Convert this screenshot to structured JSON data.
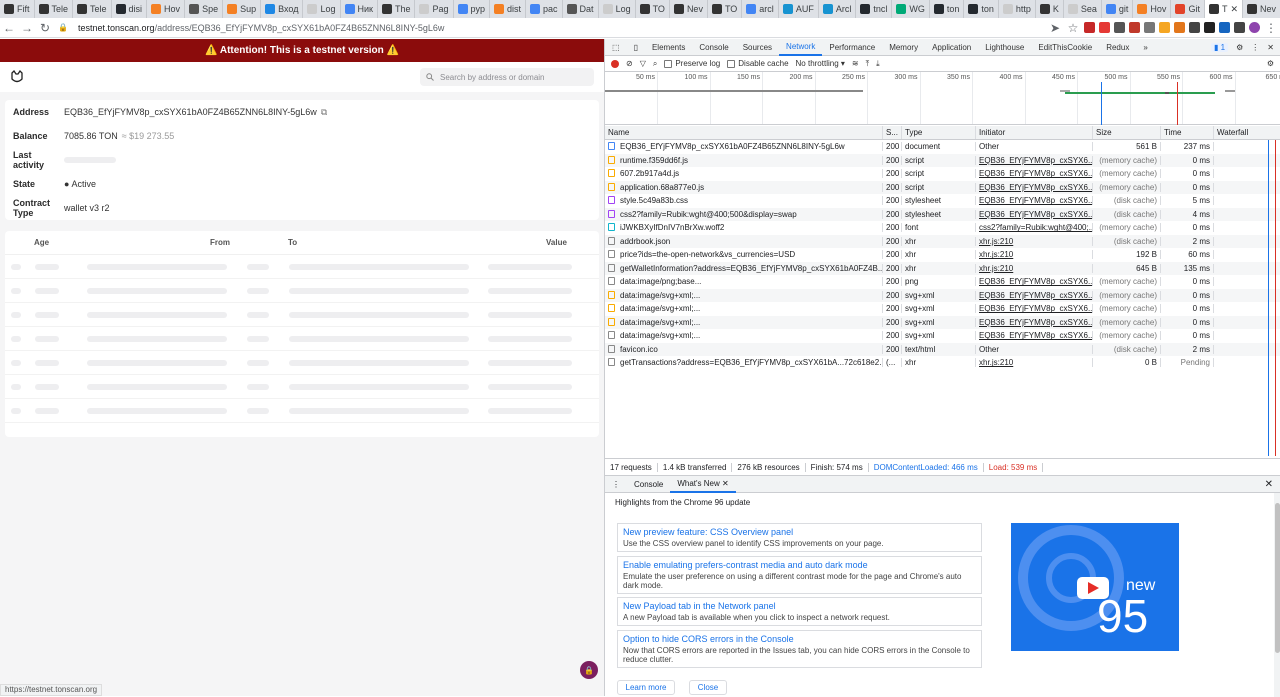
{
  "tabs": [
    {
      "label": "Fift",
      "color": "#333"
    },
    {
      "label": "Tele",
      "color": "#333"
    },
    {
      "label": "Tele",
      "color": "#333"
    },
    {
      "label": "disi",
      "color": "#24292f"
    },
    {
      "label": "Hov",
      "color": "#f48024"
    },
    {
      "label": "Spe",
      "color": "#555"
    },
    {
      "label": "Sup",
      "color": "#f48024"
    },
    {
      "label": "Вход",
      "color": "#1e88e5"
    },
    {
      "label": "Log",
      "color": "#ccc"
    },
    {
      "label": "Ник",
      "color": "#4285f4"
    },
    {
      "label": "The",
      "color": "#333"
    },
    {
      "label": "Pag",
      "color": "#ccc"
    },
    {
      "label": "pyp",
      "color": "#4285f4"
    },
    {
      "label": "dist",
      "color": "#f48024"
    },
    {
      "label": "pac",
      "color": "#4285f4"
    },
    {
      "label": "Dat",
      "color": "#555"
    },
    {
      "label": "Log",
      "color": "#ccc"
    },
    {
      "label": "TO",
      "color": "#333"
    },
    {
      "label": "Nev",
      "color": "#333"
    },
    {
      "label": "TO",
      "color": "#333"
    },
    {
      "label": "arcl",
      "color": "#4285f4"
    },
    {
      "label": "AUF",
      "color": "#1793d1"
    },
    {
      "label": "Arcl",
      "color": "#1793d1"
    },
    {
      "label": "tncl",
      "color": "#24292f"
    },
    {
      "label": "WG",
      "color": "#0a7"
    },
    {
      "label": "ton",
      "color": "#24292f"
    },
    {
      "label": "ton",
      "color": "#24292f"
    },
    {
      "label": "http",
      "color": "#ccc"
    },
    {
      "label": "K",
      "color": "#333"
    },
    {
      "label": "Sea",
      "color": "#ccc"
    },
    {
      "label": "git",
      "color": "#4285f4"
    },
    {
      "label": "Hov",
      "color": "#f48024"
    },
    {
      "label": "Git",
      "color": "#e24329"
    },
    {
      "label": "T",
      "color": "#333",
      "active": true
    },
    {
      "label": "Nev",
      "color": "#333"
    }
  ],
  "url": {
    "host": "testnet.tonscan.org",
    "path": "/address/EQB36_EfYjFYMV8p_cxSYX61bA0FZ4B65ZNN6L8INY-5gL6w"
  },
  "site": {
    "banner": "⚠️ Attention! This is a testnet version ⚠️",
    "search_placeholder": "Search by address or domain",
    "address_label": "Address",
    "address": "EQB36_EfYjFYMV8p_cxSYX61bA0FZ4B65ZNN6L8INY-5gL6w",
    "balance_label": "Balance",
    "balance": "7085.86 TON",
    "balance_usd": "≈ $19 273.55",
    "last_activity_label": "Last activity",
    "state_label": "State",
    "state": "● Active",
    "contract_label": "Contract Type",
    "contract": "wallet v3 r2",
    "cols": {
      "age": "Age",
      "from": "From",
      "to": "To",
      "value": "Value"
    },
    "status_url": "https://testnet.tonscan.org"
  },
  "devtools": {
    "tabs": [
      "Elements",
      "Console",
      "Sources",
      "Network",
      "Performance",
      "Memory",
      "Application",
      "Lighthouse",
      "EditThisCookie",
      "Redux"
    ],
    "badge": "1",
    "preserve_log": "Preserve log",
    "disable_cache": "Disable cache",
    "throttling": "No throttling",
    "timeline": [
      "50 ms",
      "100 ms",
      "150 ms",
      "200 ms",
      "250 ms",
      "300 ms",
      "350 ms",
      "400 ms",
      "450 ms",
      "500 ms",
      "550 ms",
      "600 ms",
      "650 m"
    ],
    "headers": [
      "Name",
      "S...",
      "Type",
      "Initiator",
      "Size",
      "Time",
      "Waterfall"
    ],
    "rows": [
      [
        "EQB36_EfYjFYMV8p_cxSYX61bA0FZ4B65ZNN6L8INY-5gL6w",
        "200",
        "document",
        "Other",
        "561 B",
        "237 ms"
      ],
      [
        "runtime.f359dd6f.js",
        "200",
        "script",
        "EQB36_EfYjFYMV8p_cxSYX6...",
        "(memory cache)",
        "0 ms"
      ],
      [
        "607.2b917a4d.js",
        "200",
        "script",
        "EQB36_EfYjFYMV8p_cxSYX6...",
        "(memory cache)",
        "0 ms"
      ],
      [
        "application.68a877e0.js",
        "200",
        "script",
        "EQB36_EfYjFYMV8p_cxSYX6...",
        "(memory cache)",
        "0 ms"
      ],
      [
        "style.5c49a83b.css",
        "200",
        "stylesheet",
        "EQB36_EfYjFYMV8p_cxSYX6...",
        "(disk cache)",
        "5 ms"
      ],
      [
        "css2?family=Rubik:wght@400;500&display=swap",
        "200",
        "stylesheet",
        "EQB36_EfYjFYMV8p_cxSYX6...",
        "(disk cache)",
        "4 ms"
      ],
      [
        "iJWKBXyIfDnIV7nBrXw.woff2",
        "200",
        "font",
        "css2?family=Rubik:wght@400;...",
        "(memory cache)",
        "0 ms"
      ],
      [
        "addrbook.json",
        "200",
        "xhr",
        "xhr.js:210",
        "(disk cache)",
        "2 ms"
      ],
      [
        "price?ids=the-open-network&vs_currencies=USD",
        "200",
        "xhr",
        "xhr.js:210",
        "192 B",
        "60 ms"
      ],
      [
        "getWalletInformation?address=EQB36_EfYjFYMV8p_cxSYX61bA0FZ4B...",
        "200",
        "xhr",
        "xhr.js:210",
        "645 B",
        "135 ms"
      ],
      [
        "data:image/png;base...",
        "200",
        "png",
        "EQB36_EfYjFYMV8p_cxSYX6...",
        "(memory cache)",
        "0 ms"
      ],
      [
        "data:image/svg+xml;...",
        "200",
        "svg+xml",
        "EQB36_EfYjFYMV8p_cxSYX6...",
        "(memory cache)",
        "0 ms"
      ],
      [
        "data:image/svg+xml;...",
        "200",
        "svg+xml",
        "EQB36_EfYjFYMV8p_cxSYX6...",
        "(memory cache)",
        "0 ms"
      ],
      [
        "data:image/svg+xml;...",
        "200",
        "svg+xml",
        "EQB36_EfYjFYMV8p_cxSYX6...",
        "(memory cache)",
        "0 ms"
      ],
      [
        "data:image/svg+xml;...",
        "200",
        "svg+xml",
        "EQB36_EfYjFYMV8p_cxSYX6...",
        "(memory cache)",
        "0 ms"
      ],
      [
        "favicon.ico",
        "200",
        "text/html",
        "Other",
        "(disk cache)",
        "2 ms"
      ],
      [
        "getTransactions?address=EQB36_EfYjFYMV8p_cxSYX61bA...72c618e2...",
        "(...",
        "xhr",
        "xhr.js:210",
        "0 B",
        "Pending"
      ]
    ],
    "status": [
      "17 requests",
      "1.4 kB transferred",
      "276 kB resources",
      "Finish: 574 ms",
      "DOMContentLoaded: 466 ms",
      "Load: 539 ms"
    ],
    "drawer_tabs": [
      "Console",
      "What's New"
    ],
    "highlights": "Highlights from the Chrome 96 update",
    "news": [
      {
        "title": "New preview feature: CSS Overview panel",
        "desc": "Use the CSS overview panel to identify CSS improvements on your page."
      },
      {
        "title": "Enable emulating prefers-contrast media and auto dark mode",
        "desc": "Emulate the user preference on using a different contrast mode for the page and Chrome's auto dark mode."
      },
      {
        "title": "New Payload tab in the Network panel",
        "desc": "A new Payload tab is available when you click to inspect a network request."
      },
      {
        "title": "Option to hide CORS errors in the Console",
        "desc": "Now that CORS errors are reported in the Issues tab, you can hide CORS errors in the Console to reduce clutter."
      }
    ],
    "learn_more": "Learn more",
    "close": "Close",
    "video": {
      "new": "new",
      "num": "95"
    }
  }
}
